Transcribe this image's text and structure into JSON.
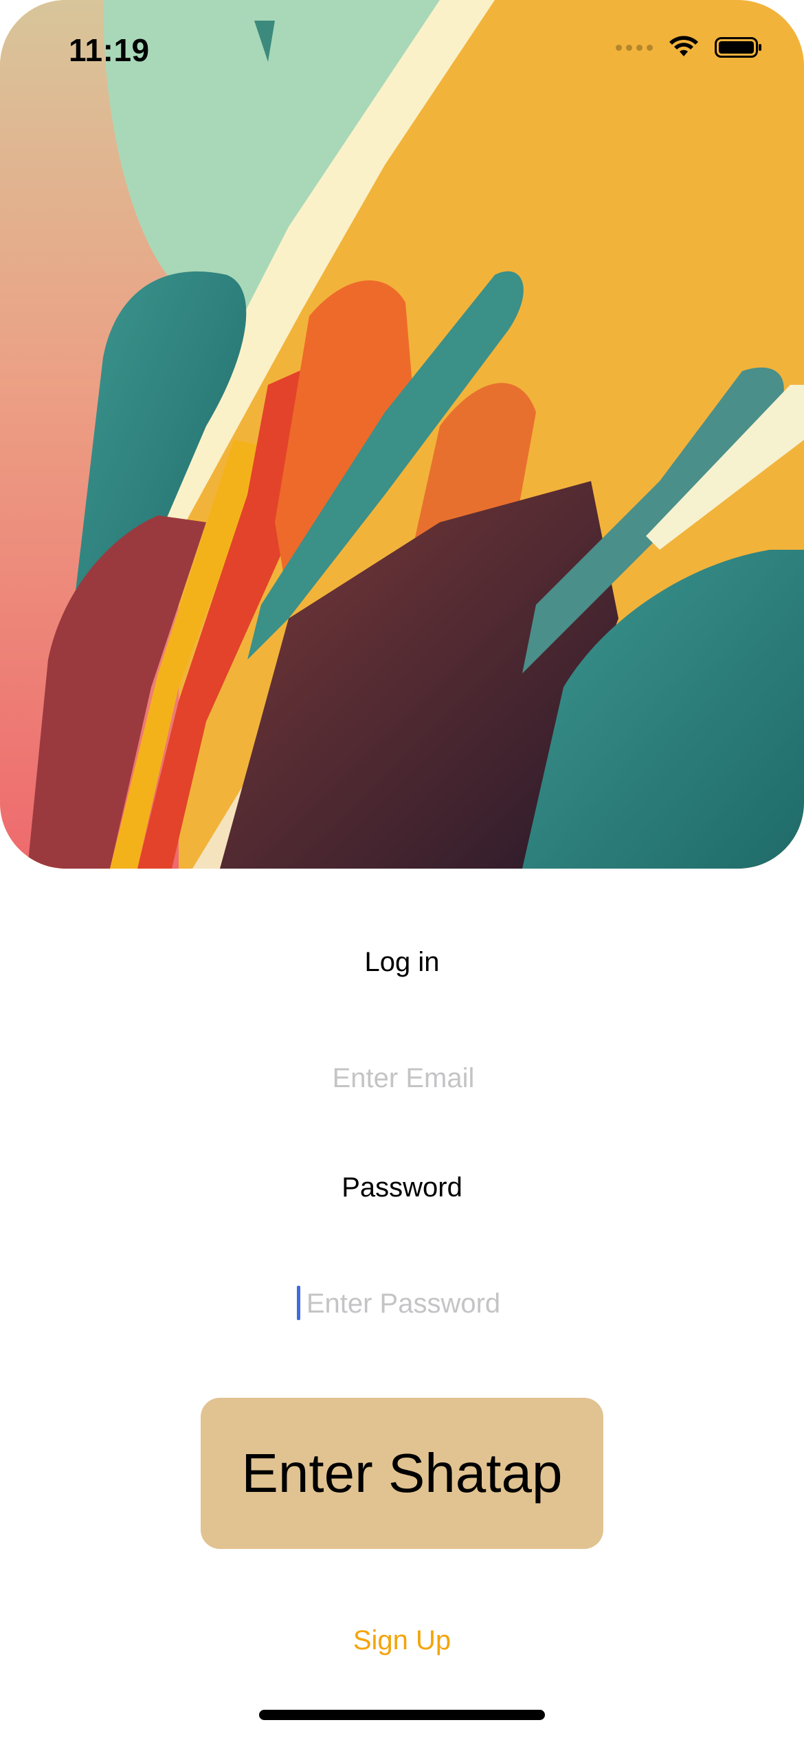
{
  "status_bar": {
    "time": "11:19",
    "icons": [
      "signal-icon",
      "wifi-icon",
      "battery-icon"
    ]
  },
  "hero": {
    "image_description_colors": [
      "#f2b33b",
      "#a9d8b8",
      "#2f8682",
      "#e2432a",
      "#fbf1c8",
      "#ef6e6e"
    ]
  },
  "form": {
    "email_label": "Log in",
    "email_placeholder": "Enter Email",
    "email_value": "",
    "password_label": "Password",
    "password_placeholder": "Enter Password",
    "password_value": ""
  },
  "actions": {
    "submit_label": "Enter Shatap",
    "signup_label": "Sign Up"
  },
  "colors": {
    "button_bg": "#e1c391",
    "link": "#f4a40a",
    "caret": "#3f6be0",
    "placeholder": "#c4c4c6"
  }
}
